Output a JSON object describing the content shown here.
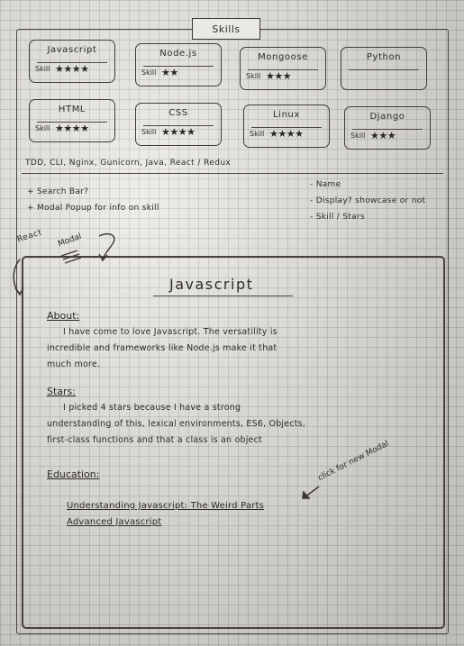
{
  "header": {
    "title": "Skills"
  },
  "cards": [
    {
      "name": "Javascript",
      "skill_label": "Skill",
      "stars": "★★★★",
      "rating": 4
    },
    {
      "name": "Node.js",
      "skill_label": "Skill",
      "stars": "★★",
      "rating": 2
    },
    {
      "name": "Mongoose",
      "skill_label": "Skill",
      "stars": "★★★",
      "rating": 3
    },
    {
      "name": "Python",
      "skill_label": "",
      "stars": "",
      "rating": 0
    },
    {
      "name": "HTML",
      "skill_label": "Skill",
      "stars": "★★★★",
      "rating": 4
    },
    {
      "name": "CSS",
      "skill_label": "Skill",
      "stars": "★★★★",
      "rating": 4
    },
    {
      "name": "Linux",
      "skill_label": "Skill",
      "stars": "★★★★",
      "rating": 4
    },
    {
      "name": "Django",
      "skill_label": "Skill",
      "stars": "★★★",
      "rating": 3
    }
  ],
  "tech_list": "TDD, CLI, Nginx, Gunicorn, Java, React / Redux",
  "notes_left": [
    "+ Search Bar?",
    "+ Modal Popup for info on skill"
  ],
  "notes_right": [
    "- Name",
    "- Display? showcase or not",
    "- Skill / Stars"
  ],
  "react_label": "React",
  "modal_label": "Modal",
  "modal": {
    "title": "Javascript",
    "about_heading": "About:",
    "about_lines": [
      "I have come to love Javascript. The versatility is",
      "incredible and frameworks like Node.js make it that",
      "much more."
    ],
    "stars_heading": "Stars:",
    "stars_lines": [
      "I picked 4 stars because I have a strong",
      "understanding of this, lexical environments, ES6, Objects,",
      "first-class functions and that a class is an object"
    ],
    "education_heading": "Education:",
    "education_items": [
      "Understanding Javascript: The Weird Parts",
      "Advanced Javascript"
    ],
    "annotation": "click for new Modal"
  }
}
